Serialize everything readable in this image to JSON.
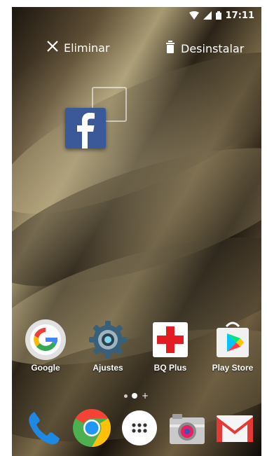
{
  "status_bar": {
    "time": "17:11",
    "icons": [
      "wifi-icon",
      "signal-icon",
      "battery-icon"
    ]
  },
  "drop_targets": {
    "remove_label": "Eliminar",
    "uninstall_label": "Desinstalar",
    "remove_icon": "close-icon",
    "uninstall_icon": "trash-icon"
  },
  "dragged_app": {
    "icon": "facebook-icon",
    "brand_color": "#3b5998"
  },
  "apps": [
    {
      "label": "Google",
      "icon": "google-icon"
    },
    {
      "label": "Ajustes",
      "icon": "settings-icon"
    },
    {
      "label": "BQ Plus",
      "icon": "bq-plus-icon"
    },
    {
      "label": "Play Store",
      "icon": "play-store-icon"
    }
  ],
  "page_indicator": {
    "pages": 2,
    "active_page": 2,
    "add_page_icon": "plus-icon"
  },
  "dock": [
    {
      "icon": "phone-icon"
    },
    {
      "icon": "chrome-icon"
    },
    {
      "icon": "app-drawer-icon"
    },
    {
      "icon": "camera-icon"
    },
    {
      "icon": "gmail-icon"
    }
  ]
}
